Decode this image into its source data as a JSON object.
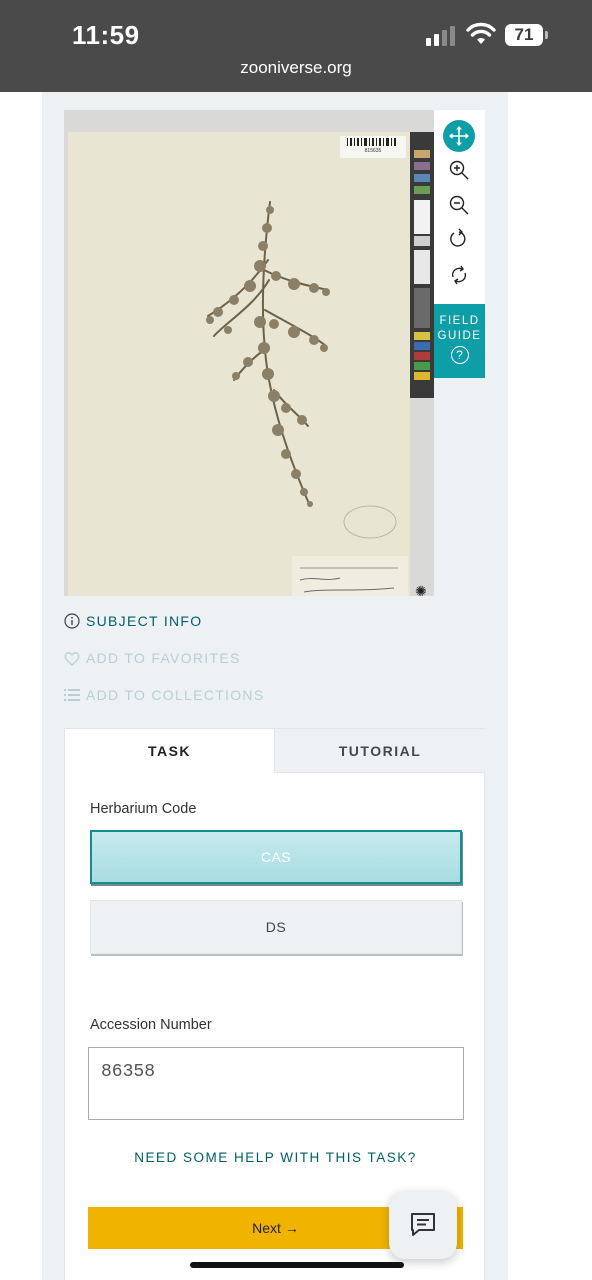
{
  "status_bar": {
    "time": "11:59",
    "battery": "71",
    "url": "zooniverse.org"
  },
  "subject_viewer": {
    "image_alt": "Herbarium specimen sheet",
    "barcode_text": "815635",
    "tools": [
      {
        "name": "pan",
        "icon": "move-icon"
      },
      {
        "name": "zoom-in",
        "icon": "zoom-in-icon"
      },
      {
        "name": "zoom-out",
        "icon": "zoom-out-icon"
      },
      {
        "name": "rotate",
        "icon": "rotate-icon"
      },
      {
        "name": "reset",
        "icon": "reset-icon"
      }
    ],
    "field_guide": {
      "line1": "FIELD",
      "line2": "GUIDE",
      "q": "?"
    },
    "accent_color": "#0e9ea7"
  },
  "meta_links": {
    "subject_info": "SUBJECT INFO",
    "add_to_favorites": "ADD TO FAVORITES",
    "add_to_collections": "ADD TO COLLECTIONS"
  },
  "task_panel": {
    "tabs": [
      {
        "label": "TASK",
        "active": true
      },
      {
        "label": "TUTORIAL",
        "active": false
      }
    ],
    "herbarium_question": "Herbarium Code",
    "choices": [
      {
        "label": "CAS",
        "selected": true
      },
      {
        "label": "DS",
        "selected": false
      }
    ],
    "accession_question": "Accession Number",
    "accession_value": "86358",
    "help_link": "NEED SOME HELP WITH THIS TASK?",
    "next_label": "Next →",
    "next_color": "#f0b300"
  }
}
